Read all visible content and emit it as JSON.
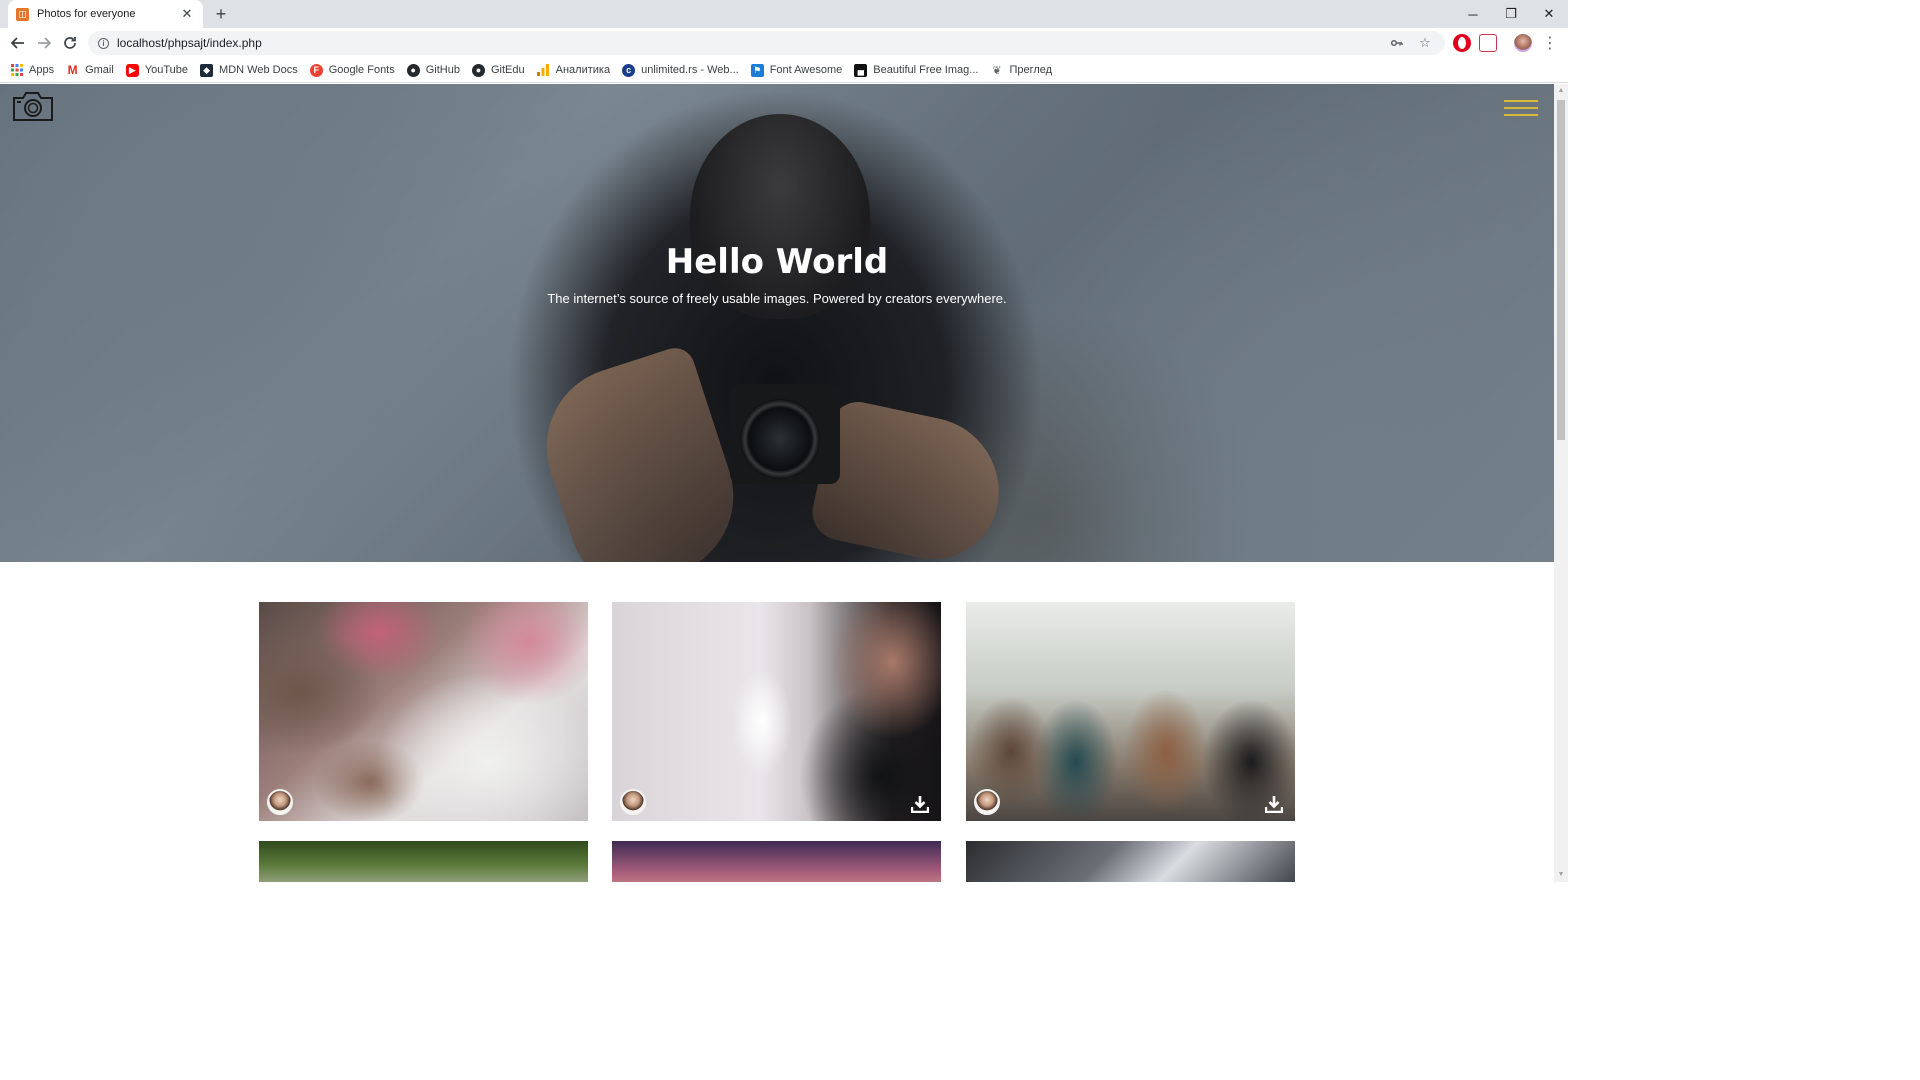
{
  "browser": {
    "tab": {
      "title": "Photos for everyone",
      "favicon": "phpsajt-favicon",
      "close": "✕"
    },
    "new_tab": "+",
    "window_controls": {
      "minimize": "─",
      "restore": "❐",
      "close": "✕"
    },
    "url": "localhost/phpsajt/index.php",
    "bookmarks": [
      {
        "label": "Apps",
        "icon": "apps-grid-icon",
        "color": "#4285f4"
      },
      {
        "label": "Gmail",
        "icon": "gmail-icon",
        "color": "#d93025"
      },
      {
        "label": "YouTube",
        "icon": "youtube-icon",
        "color": "#ff0000"
      },
      {
        "label": "MDN Web Docs",
        "icon": "mdn-icon",
        "color": "#1c2a3a"
      },
      {
        "label": "Google Fonts",
        "icon": "google-fonts-icon",
        "color": "#ea4335"
      },
      {
        "label": "GitHub",
        "icon": "github-icon",
        "color": "#24292e"
      },
      {
        "label": "GitEdu",
        "icon": "github-icon",
        "color": "#24292e"
      },
      {
        "label": "Аналитика",
        "icon": "analytics-icon",
        "color": "#f9ab00"
      },
      {
        "label": "unlimited.rs - Web...",
        "icon": "unlimited-icon",
        "color": "#1a3d8f"
      },
      {
        "label": "Font Awesome",
        "icon": "font-awesome-icon",
        "color": "#1c7cd6"
      },
      {
        "label": "Beautiful Free Imag...",
        "icon": "unsplash-icon",
        "color": "#111111"
      },
      {
        "label": "Преглед",
        "icon": "preview-icon",
        "color": "#5f6368"
      }
    ]
  },
  "page": {
    "hero": {
      "title": "Hello World",
      "subtitle": "The internet’s source of freely usable images. Powered by creators everywhere."
    },
    "accent_color": "#d9b93a",
    "photos": [
      {
        "alt": "children-crafting-photo"
      },
      {
        "alt": "man-writing-on-fridge-photo"
      },
      {
        "alt": "women-toasting-photo"
      },
      {
        "alt": "palm-trees-photo"
      },
      {
        "alt": "sunset-sky-photo"
      },
      {
        "alt": "skyscrapers-photo"
      }
    ]
  }
}
